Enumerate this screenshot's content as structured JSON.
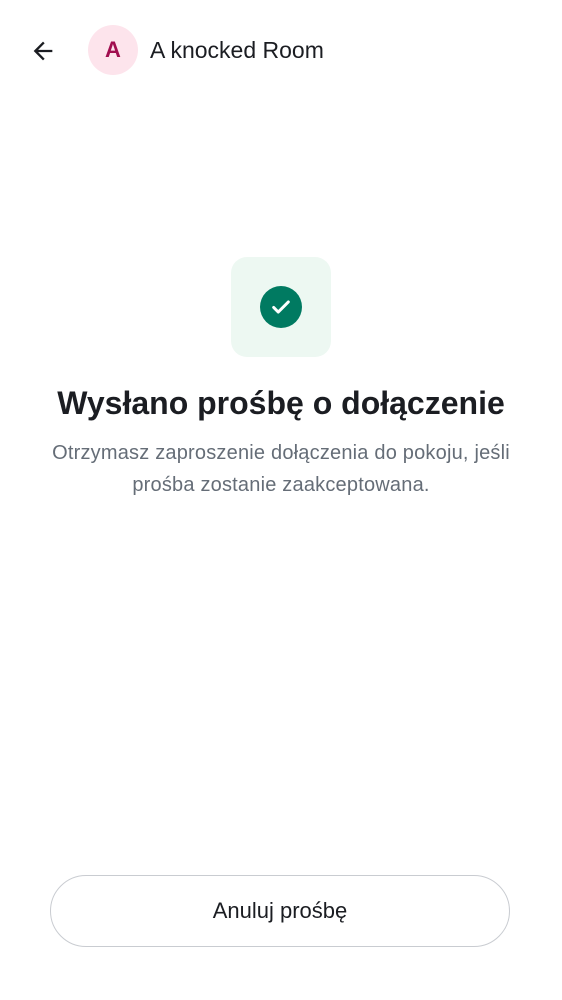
{
  "header": {
    "back_icon": "arrow-left-icon",
    "avatar_letter": "A",
    "room_name": "A knocked Room"
  },
  "status": {
    "icon": "check-circle-icon",
    "title": "Wysłano prośbę o dołączenie",
    "description": "Otrzymasz zaproszenie dołączenia do pokoju, jeśli prośba zostanie zaakceptowana."
  },
  "actions": {
    "cancel_label": "Anuluj prośbę"
  },
  "colors": {
    "accent_green": "#007a61",
    "tile_background": "#edf8f2",
    "avatar_background": "#fde4ec",
    "avatar_text": "#a10e4f",
    "text_primary": "#1b1d22",
    "text_secondary": "#656d77",
    "button_border": "#c9ccd1"
  }
}
